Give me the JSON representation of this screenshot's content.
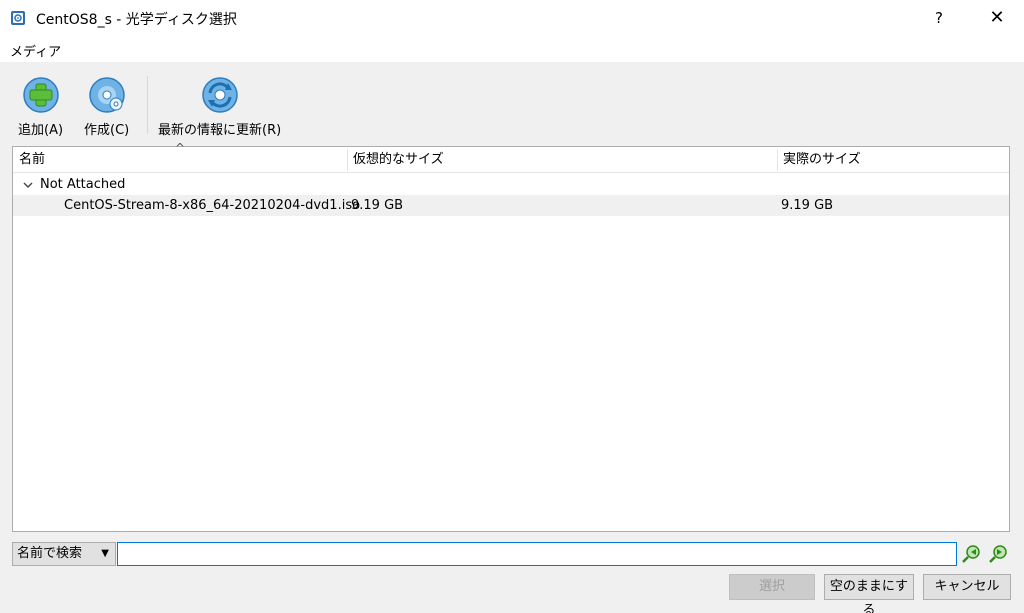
{
  "window": {
    "title": "CentOS8_s - 光学ディスク選択",
    "help_label": "?",
    "close_label": "✕"
  },
  "menu": {
    "items": [
      "メディア"
    ]
  },
  "toolbar": {
    "add_label": "追加(A)",
    "create_label": "作成(C)",
    "refresh_label": "最新の情報に更新(R)"
  },
  "table": {
    "columns": [
      "名前",
      "仮想的なサイズ",
      "実際のサイズ"
    ],
    "sort_indicator": "^",
    "groups": [
      {
        "label": "Not Attached",
        "expanded": true,
        "rows": [
          {
            "name": "CentOS-Stream-8-x86_64-20210204-dvd1.iso",
            "virtual_size": "9.19 GB",
            "actual_size": "9.19 GB"
          }
        ]
      }
    ]
  },
  "search": {
    "mode_label": "名前で検索",
    "value": "",
    "find_prev_icon": "find-previous-icon",
    "find_next_icon": "find-next-icon"
  },
  "buttons": {
    "choose_label": "選択",
    "leave_empty_label": "空のままにする",
    "cancel_label": "キャンセル"
  },
  "colors": {
    "accent": "#0078d7",
    "selected_row": "#f0f0f0",
    "disabled_text": "#a0a0a0"
  }
}
